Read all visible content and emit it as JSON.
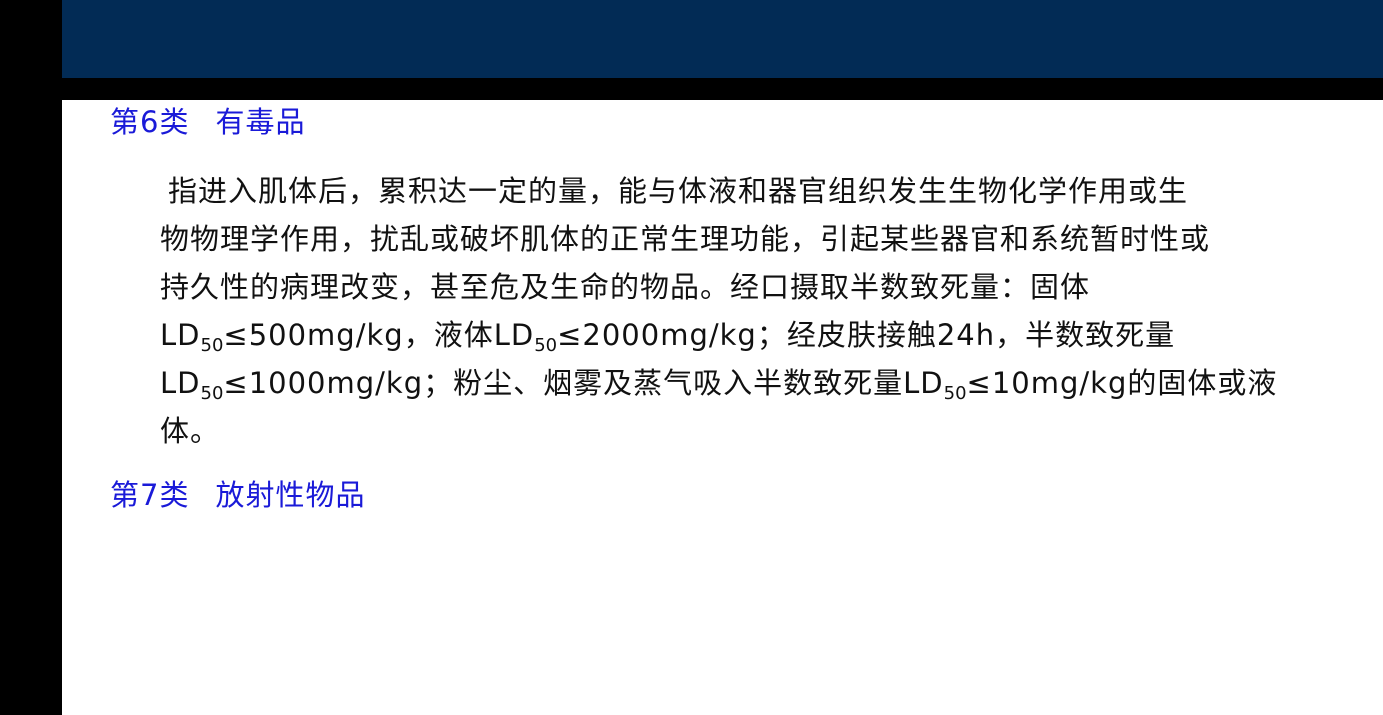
{
  "header": {
    "band_color": "#022b55"
  },
  "section6": {
    "label": "第6类",
    "title": "有毒品",
    "lines": [
      {
        "text": "指进入肌体后，累积达一定的量，能与体液和器官组织发生生物化学作用或生"
      },
      {
        "text": "物物理学作用，扰乱或破坏肌体的正常生理功能，引起某些器官和系统暂时性或"
      },
      {
        "text": "持久性的病理改变，甚至危及生命的物品。经口摄取半数致死量：固体"
      },
      {
        "a": "LD",
        "b": "50",
        "c": "≤500mg/kg，液体LD",
        "d": "50",
        "e": "≤2000mg/kg；经皮肤接触24h，半数致死量"
      },
      {
        "a": "LD",
        "b": "50",
        "c": "≤1000mg/kg；粉尘、烟雾及蒸气吸入半数致死量LD",
        "d": "50",
        "e": "≤10mg/kg的固体或液"
      },
      {
        "text": "体。"
      }
    ]
  },
  "section7": {
    "label": "第7类",
    "title": "放射性物品"
  },
  "colors": {
    "heading": "#1a1ad8",
    "body_text": "#111111",
    "background": "#000000",
    "slide": "#ffffff"
  }
}
